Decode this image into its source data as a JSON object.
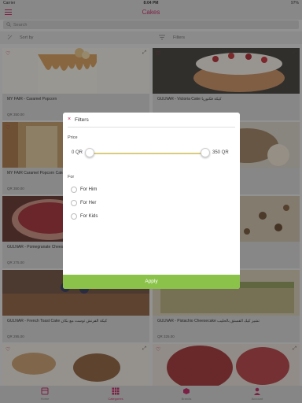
{
  "status_bar": {
    "carrier": "Carrier",
    "time": "8:04 PM",
    "battery": "97%"
  },
  "header": {
    "title": "Cakes"
  },
  "search": {
    "placeholder": "Search"
  },
  "sort_filter": {
    "sort_label": "Sort by",
    "filter_label": "Filters"
  },
  "products": [
    {
      "name": "MY FAIR - Caramel Popcorn",
      "price": "QR 350.00"
    },
    {
      "name": "GULNAR - Victoria Cake كيكة فكتوريا",
      "price": "QR 350.00"
    },
    {
      "name": "MY FAIR Caramel Popcorn Cake",
      "price": "QR 350.00"
    },
    {
      "name": "كيكة",
      "price": ""
    },
    {
      "name": "GULNAR - Pomegranate Cheesecake",
      "price": "QR 275.00"
    },
    {
      "name": "",
      "price": ""
    },
    {
      "name": "GULNAR - French Toast Cake كيكة الفرنش توست مع بكان",
      "price": "QR 295.00"
    },
    {
      "name": "GULNAR - Pistachio Cheesecake تشيز كيك الفستق بالحليب",
      "price": "QR 325.00"
    },
    {
      "name": "",
      "price": ""
    },
    {
      "name": "",
      "price": ""
    }
  ],
  "filter_modal": {
    "title": "Filters",
    "close_symbol": "×",
    "price_label": "Price",
    "price_min": "0 QR",
    "price_max": "350 QR",
    "for_label": "For",
    "options": [
      "For Him",
      "For Her",
      "For Kids"
    ],
    "apply_label": "Apply",
    "slider_color": "#d9cc7a",
    "apply_color": "#8bc34a"
  },
  "tabs": [
    {
      "label": "Home",
      "icon": "home-icon",
      "active": false
    },
    {
      "label": "Categories",
      "icon": "grid-icon",
      "active": true
    },
    {
      "label": "Brands",
      "icon": "brands-icon",
      "active": false
    },
    {
      "label": "Account",
      "icon": "account-icon",
      "active": false
    }
  ],
  "colors": {
    "brand": "#c2185b",
    "apply": "#8bc34a"
  }
}
